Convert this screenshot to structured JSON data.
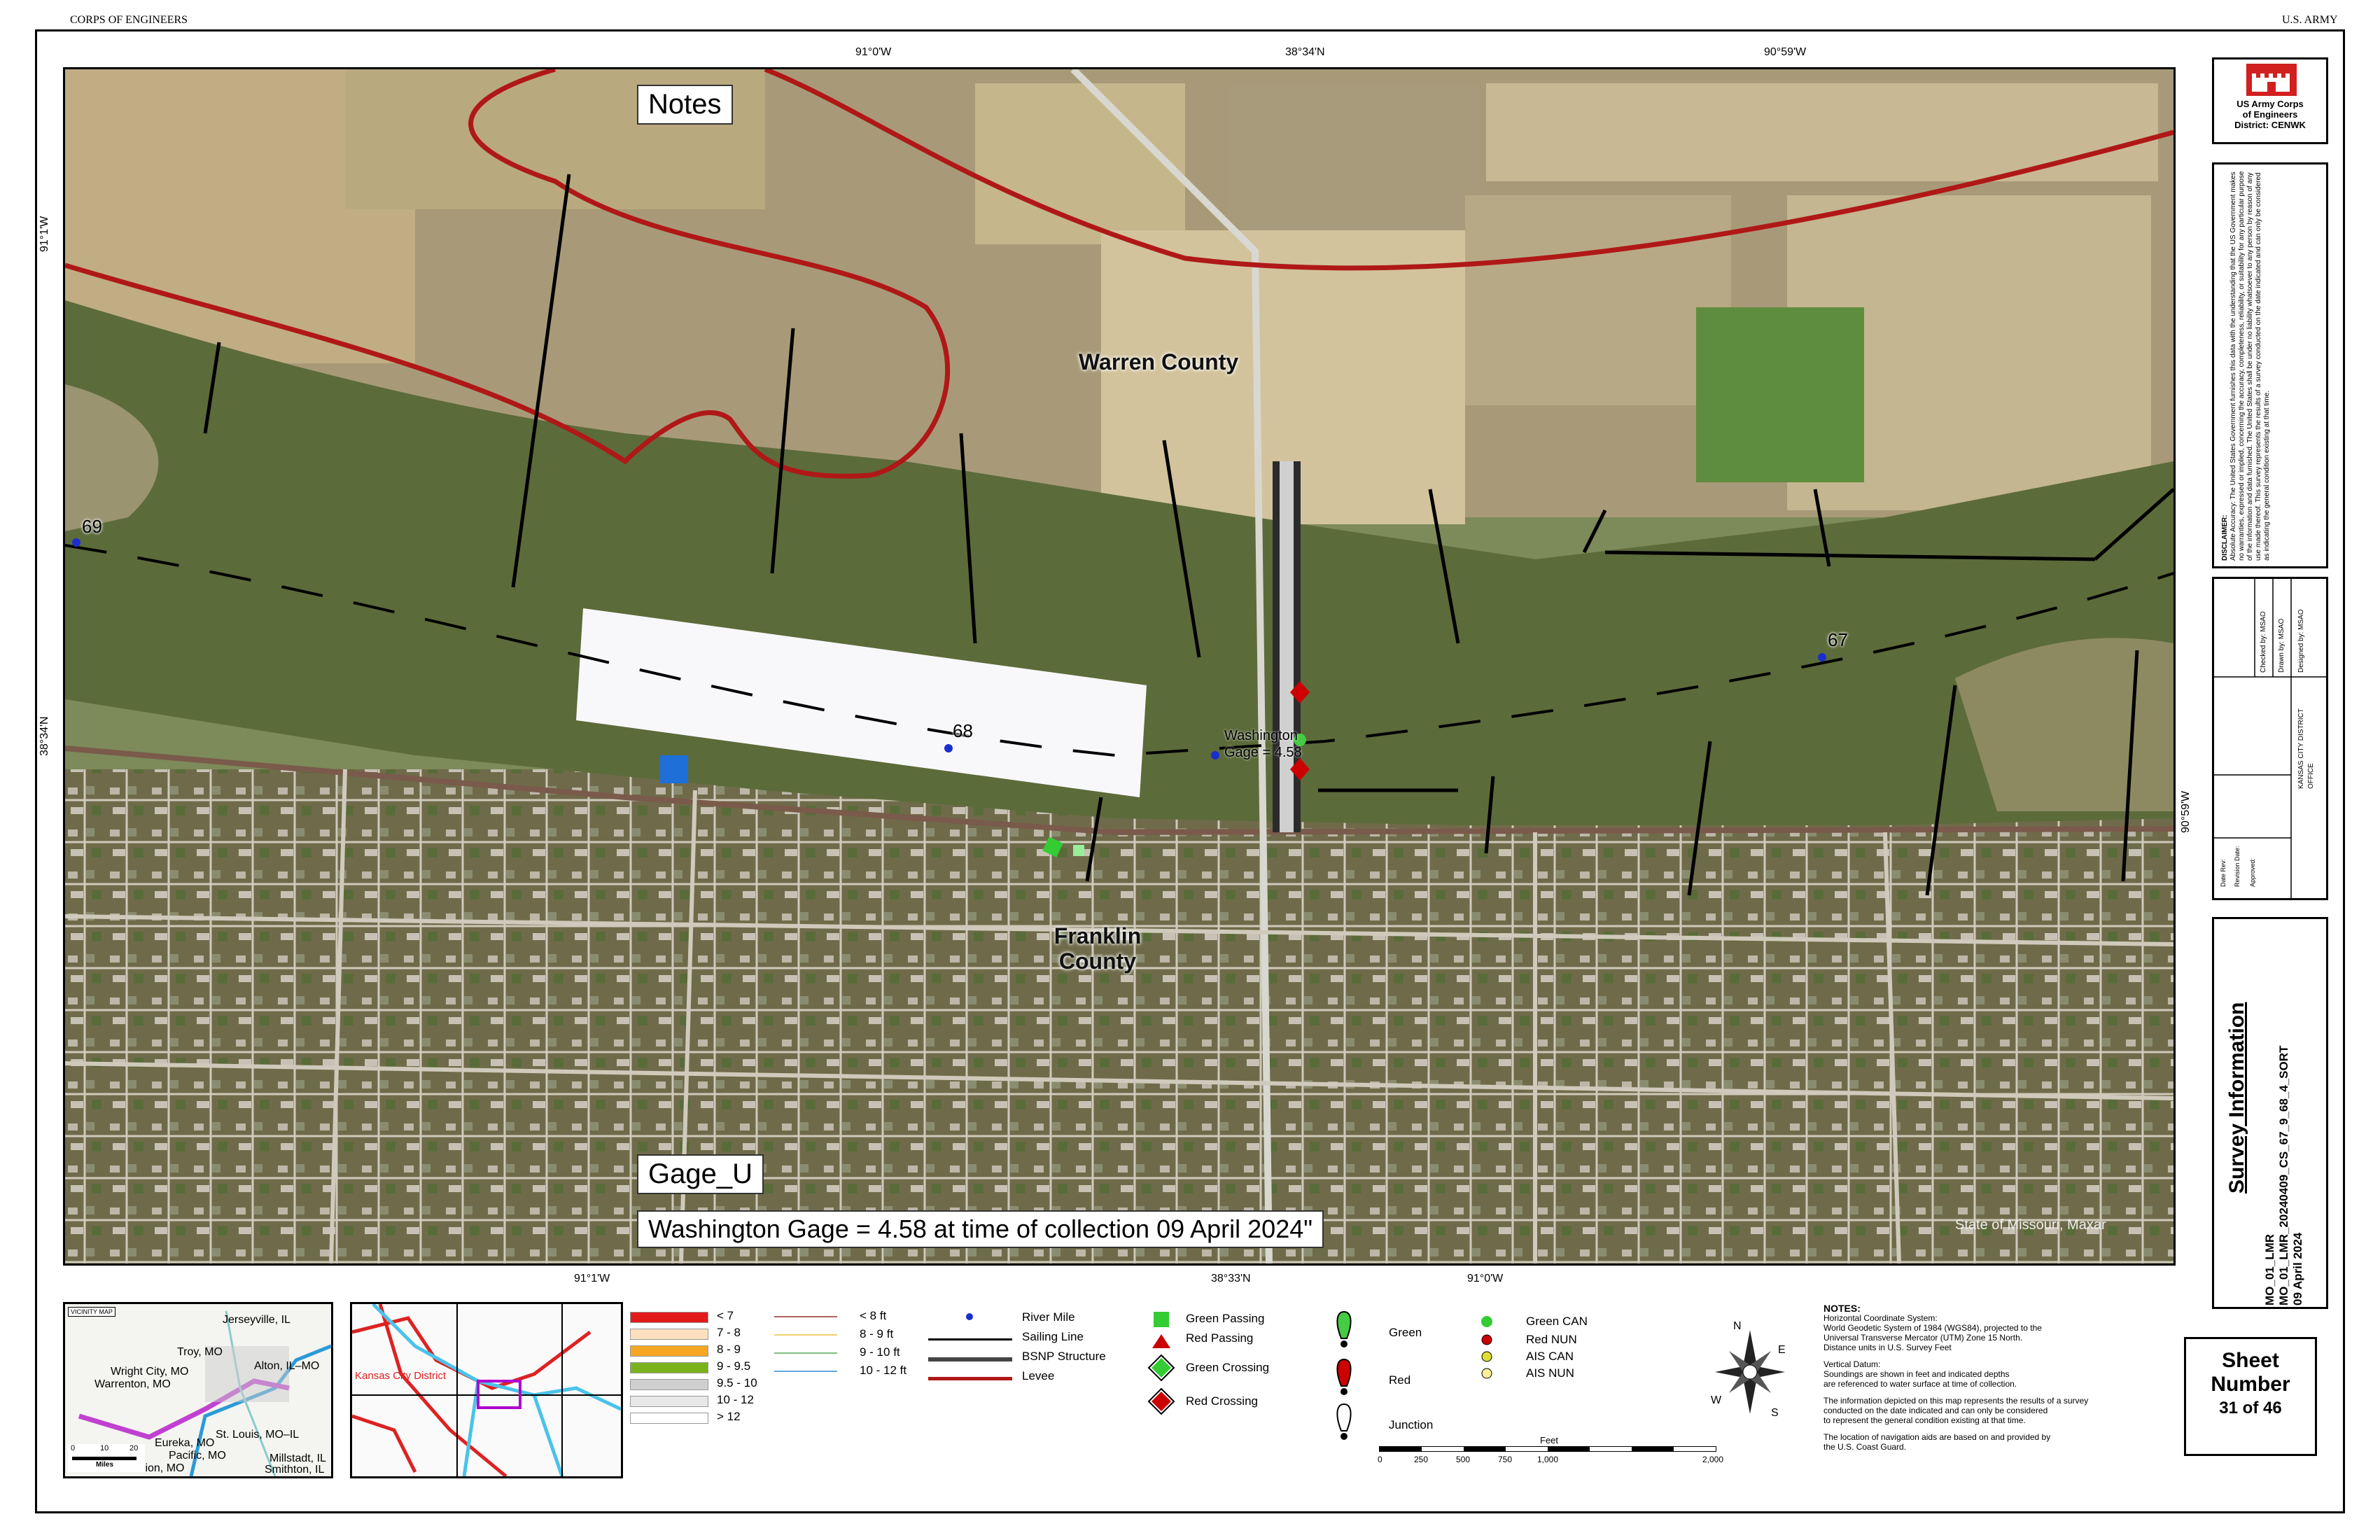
{
  "header": {
    "left": "CORPS OF ENGINEERS",
    "right": "U.S. ARMY"
  },
  "coords": {
    "top": [
      "91°0'W",
      "38°34'N",
      "90°59'W"
    ],
    "left": [
      "91°1'W",
      "38°34'N"
    ],
    "bottom": [
      "91°1'W",
      "38°33'N",
      "91°0'W"
    ],
    "right": [
      "90°59'W"
    ]
  },
  "map": {
    "notes_label": "Notes",
    "gage_label": "Gage_U",
    "gage_text": "Washington Gage = 4.58 at time of collection 09 April 2024\"",
    "counties": [
      "Warren County",
      "Franklin County"
    ],
    "river_miles": [
      "69",
      "68",
      "67"
    ],
    "gage_point_label": "Washington Gage = 4.58",
    "attribution": "State of Missouri, Maxar",
    "colors": {
      "river": "#5c6b3a",
      "levee": "#b01818",
      "survey": "#f8f8fa",
      "sailing": "#000000"
    }
  },
  "titleblock": {
    "usace_line1": "US Army Corps",
    "usace_line2": "of Engineers",
    "district": "District: CENWK",
    "disclaimer_title": "DISCLAIMER:",
    "disclaimer": "Absolute Accuracy: The United States Government furnishes this data with the understanding that the US Government makes no warranties, expressed or implied, concerning the accuracy, completeness, reliability, or suitability for any particular purpose of the information and data furnished. The United States shall be under no liability whatsoever to any person by reason of any use made thereof. This survey represents the results of a survey conducted on the date indicated and can only be considered as indicating the general condition existing at that time.",
    "designed_label": "Designed by:",
    "designed_value": "MSAO",
    "drawn_label": "Drawn by:",
    "drawn_value": "MSAO",
    "checked_label": "Checked by:",
    "checked_value": "MSAO",
    "office": "KANSAS CITY DISTRICT OFFICE",
    "date_label": "Date Rev:",
    "revision_label": "Revision Date:",
    "approval_label": "Approved:",
    "survey_info": "Survey Information",
    "survey_id_1": "MO_01_LMR",
    "survey_id_2": "MO_01_LMR_20240409_CS_67_9_68_4_SORT",
    "survey_date": "09 April 2024",
    "sheet_label": "Sheet",
    "number_label": "Number",
    "sheet_value": "31 of 46"
  },
  "vicinity": {
    "title": "VICINITY MAP",
    "places": [
      "Jerseyville, IL",
      "Troy, MO",
      "Wright City, MO",
      "Warrenton, MO",
      "Alton, IL–MO",
      "St. Louis, MO–IL",
      "Eureka, MO",
      "Pacific, MO",
      "Union, MO",
      "Millstadt, IL",
      "Smithton, IL"
    ],
    "scale": [
      "0",
      "10",
      "20"
    ],
    "scale_unit": "Miles",
    "district_label": "Kansas City District"
  },
  "legend": {
    "depth_items": [
      {
        "label": "< 7",
        "color": "#e31a1c"
      },
      {
        "label": "7 - 8",
        "color": "#fde0c0"
      },
      {
        "label": "8 - 9",
        "color": "#f5a623"
      },
      {
        "label": "9 - 9.5",
        "color": "#7ab21e"
      },
      {
        "label": "9.5 - 10",
        "color": "#cfcfcf"
      },
      {
        "label": "10 - 12",
        "color": "#e8e8e8"
      },
      {
        "label": "> 12",
        "color": "#ffffff"
      }
    ],
    "contour_items": [
      {
        "label": "< 8 ft",
        "color": "#b06060"
      },
      {
        "label": "8 - 9 ft",
        "color": "#f0d070"
      },
      {
        "label": "9 - 10 ft",
        "color": "#80c080"
      },
      {
        "label": "10 - 12 ft",
        "color": "#60a8e0"
      }
    ],
    "line_items": [
      {
        "label": "River Mile",
        "kind": "dot"
      },
      {
        "label": "Sailing Line",
        "kind": "line"
      },
      {
        "label": "BSNP Structure",
        "kind": "thick"
      },
      {
        "label": "Levee",
        "kind": "levee"
      }
    ],
    "nav_items": [
      "Green Passing",
      "Red Passing",
      "Green Crossing",
      "Red Crossing"
    ],
    "buoy_items": [
      "Green",
      "Red",
      "Junction"
    ],
    "can_items": [
      "Green CAN",
      "Red NUN",
      "AIS CAN",
      "AIS NUN"
    ],
    "compass": [
      "N",
      "E",
      "S",
      "W"
    ],
    "scale_title": "Feet",
    "scale_ticks": [
      "0",
      "250",
      "500",
      "750",
      "1,000",
      "2,000"
    ]
  },
  "notes": {
    "title": "NOTES:",
    "lines": [
      "Horizontal Coordinate System:",
      "World Geodetic System of 1984 (WGS84), projected to the",
      "Universal Transverse Mercator (UTM) Zone 15 North.",
      "Distance units in U.S. Survey Feet",
      "",
      "Vertical Datum:",
      "Soundings are shown in feet and indicated depths",
      "are referenced to water surface at time of collection.",
      "",
      "The information depicted on this map represents the results of a survey",
      "conducted on the date indicated and can only be considered",
      "to represent the general condition existing at that time.",
      "",
      "The location of navigation aids are based on and provided by",
      "the U.S. Coast Guard."
    ]
  }
}
